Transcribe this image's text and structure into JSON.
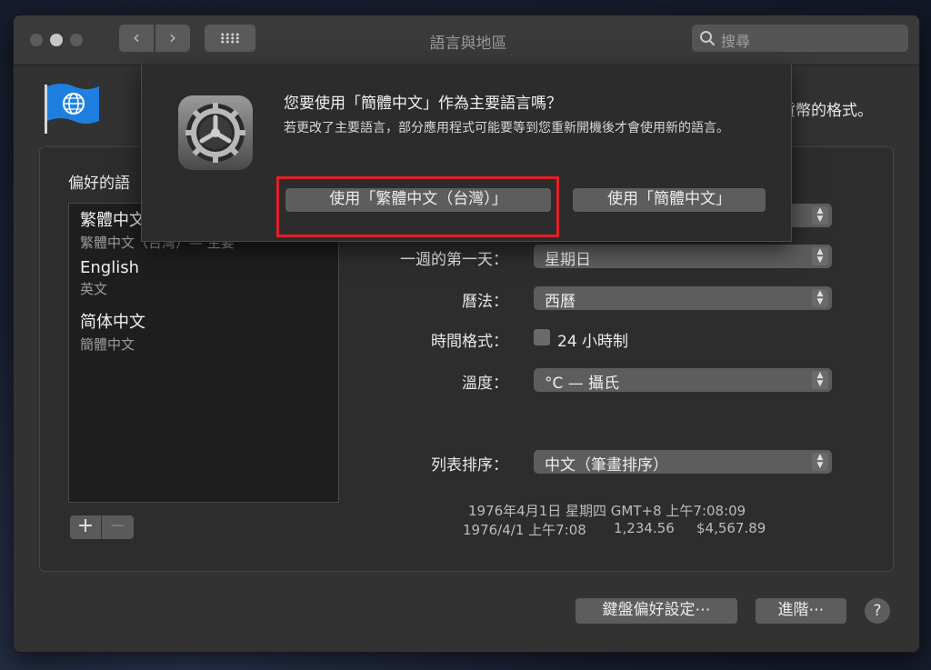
{
  "window": {
    "title": "語言與地區"
  },
  "toolbar": {
    "back": "‹",
    "forward": "›",
    "search_placeholder": "搜尋"
  },
  "header": {
    "hint_tail": "貨幣的格式。"
  },
  "preferred_languages": {
    "label": "偏好的語",
    "items": [
      {
        "name": "繁體中文",
        "sub": "繁體中文（台灣）— 主要"
      },
      {
        "name": "English",
        "sub": "英文"
      },
      {
        "name": "简体中文",
        "sub": "簡體中文"
      }
    ],
    "add": "+",
    "remove": "−"
  },
  "settings": {
    "first_day_label": "一週的第一天：",
    "first_day_value": "星期日",
    "calendar_label": "曆法：",
    "calendar_value": "西曆",
    "time_format_label": "時間格式：",
    "time_format_option": "24 小時制",
    "time_format_checked": false,
    "temperature_label": "溫度：",
    "temperature_value": "°C — 攝氏",
    "list_sort_label": "列表排序：",
    "list_sort_value": "中文（筆畫排序）"
  },
  "sample": {
    "line1": "1976年4月1日 星期四 GMT+8 上午7:08:09",
    "line2_date": "1976/4/1 上午7:08",
    "line2_number": "1,234.56",
    "line2_currency": "$4,567.89"
  },
  "bottom": {
    "keyboard": "鍵盤偏好設定⋯",
    "advanced": "進階⋯",
    "help": "?"
  },
  "dialog": {
    "title": "您要使用「簡體中文」作為主要語言嗎？",
    "body": "若更改了主要語言，部分應用程式可能要等到您重新開機後才會使用新的語言。",
    "primary": "使用「繁體中文（台灣）」",
    "secondary": "使用「簡體中文」"
  },
  "colors": {
    "highlight": "#e0202a",
    "flag": "#1e7fe0"
  },
  "icons": [
    "flag-globe-icon",
    "gear-icon",
    "search-icon",
    "chevron-updown-icon"
  ]
}
